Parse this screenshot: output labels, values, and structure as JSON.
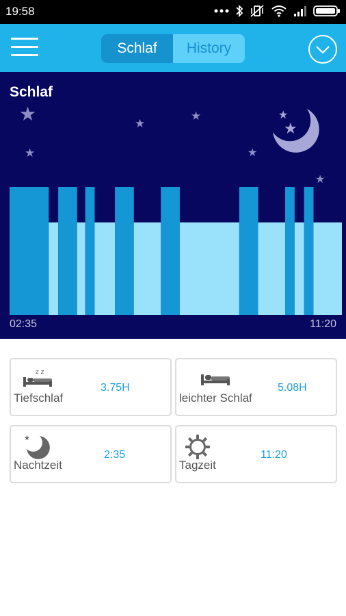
{
  "status_bar": {
    "time": "19:58"
  },
  "app_bar": {
    "tabs": [
      {
        "label": "Schlaf",
        "active": true
      },
      {
        "label": "History",
        "active": false
      }
    ]
  },
  "sleep_panel": {
    "title": "Schlaf",
    "start_time": "02:35",
    "end_time": "11:20"
  },
  "chart_data": {
    "type": "bar",
    "legend": [
      "deep sleep",
      "light sleep"
    ],
    "x_range": [
      "02:35",
      "11:20"
    ],
    "segments": [
      {
        "start_min": 0,
        "end_min": 29,
        "stage": "deep"
      },
      {
        "start_min": 29,
        "end_min": 36,
        "stage": "light"
      },
      {
        "start_min": 36,
        "end_min": 50,
        "stage": "deep"
      },
      {
        "start_min": 50,
        "end_min": 56,
        "stage": "light"
      },
      {
        "start_min": 56,
        "end_min": 63,
        "stage": "deep"
      },
      {
        "start_min": 63,
        "end_min": 78,
        "stage": "light"
      },
      {
        "start_min": 78,
        "end_min": 92,
        "stage": "deep"
      },
      {
        "start_min": 92,
        "end_min": 112,
        "stage": "light"
      },
      {
        "start_min": 112,
        "end_min": 126,
        "stage": "deep"
      },
      {
        "start_min": 126,
        "end_min": 170,
        "stage": "light"
      },
      {
        "start_min": 170,
        "end_min": 184,
        "stage": "deep"
      },
      {
        "start_min": 184,
        "end_min": 204,
        "stage": "light"
      },
      {
        "start_min": 204,
        "end_min": 211,
        "stage": "deep"
      },
      {
        "start_min": 211,
        "end_min": 218,
        "stage": "light"
      },
      {
        "start_min": 218,
        "end_min": 225,
        "stage": "deep"
      },
      {
        "start_min": 225,
        "end_min": 246,
        "stage": "light"
      }
    ],
    "colors": {
      "deep": "#1597d5",
      "light": "#9ae2fb",
      "background": "#070760"
    }
  },
  "cards": [
    {
      "label": "Tiefschlaf",
      "value": "3.75H",
      "icon": "deep-sleep-icon"
    },
    {
      "label": "leichter Schlaf",
      "value": "5.08H",
      "icon": "light-sleep-icon"
    },
    {
      "label": "Nachtzeit",
      "value": "2:35",
      "icon": "moon-icon"
    },
    {
      "label": "Tagzeit",
      "value": "11:20",
      "icon": "sun-icon"
    }
  ]
}
